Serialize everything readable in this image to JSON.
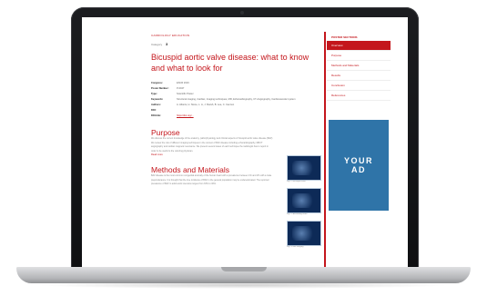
{
  "article": {
    "breadcrumb": "CARDIOLOGY EDUCATION",
    "category_prefix": "Category",
    "category_value": "3",
    "title": "Bicuspid aortic valve disease: what to know and what to look for",
    "meta": [
      {
        "key": "Congress:",
        "value": "ESCR 2016"
      },
      {
        "key": "Poster Number:",
        "value": "P-0047"
      },
      {
        "key": "Type:",
        "value": "Scientific Poster"
      },
      {
        "key": "Keywords:",
        "value": "Structural imaging, Cardiac, Imaging techniques, MR, Echocardiography, CT-Angiography, Cardiovascular system"
      },
      {
        "key": "Authors:",
        "value": "A. Alberts, H. Stone, L. Li, J. Marsh, B. Lee, C. Cannon"
      },
      {
        "key": "DOI:",
        "value": ""
      },
      {
        "key": "DOI-link:",
        "value": "https://doi.org/..."
      }
    ],
    "purpose_heading": "Purpose",
    "purpose_text": "We discuss the current knowledge of the anatomy, pathophysiology and clinical aspects of bicuspid aortic valve disease (BAV). We review the role of different imaging techniques in the context of BAV disease including echocardiography, MDCT angiography and cardiac magnetic resonance. We present several cases of each technique the radiologist has to report in order to be useful to the referring physician.",
    "read_more": "Read more",
    "methods_heading": "Methods and Materials",
    "methods_text": "BAV disease is the most common congenital anomaly of the human heart with a prevalence between 1% and 2% with a male preponderance. It is thought that the true incidence of BAV in the general population may be underestimated. The reported prevalence of BAV in adult aortic stenosis ranges from 33% to 40%."
  },
  "thumbnails": [
    {
      "caption": "Fig. 1: Bicuspid valve"
    },
    {
      "caption": "Fig. 2: Ascending aorta"
    },
    {
      "caption": "Fig. 3: MR imaging"
    }
  ],
  "sidebar": {
    "title": "POSTER SECTIONS",
    "items": [
      {
        "label": "Overview",
        "active": true
      },
      {
        "label": "Purpose",
        "active": false
      },
      {
        "label": "Methods and Materials",
        "active": false
      },
      {
        "label": "Results",
        "active": false
      },
      {
        "label": "Conclusion",
        "active": false
      },
      {
        "label": "References",
        "active": false
      }
    ]
  },
  "ad": {
    "line1": "YOUR",
    "line2": "AD"
  },
  "colors": {
    "accent": "#c4161c",
    "ad_background": "#2f74a8",
    "laptop_bezel": "#16171a"
  }
}
